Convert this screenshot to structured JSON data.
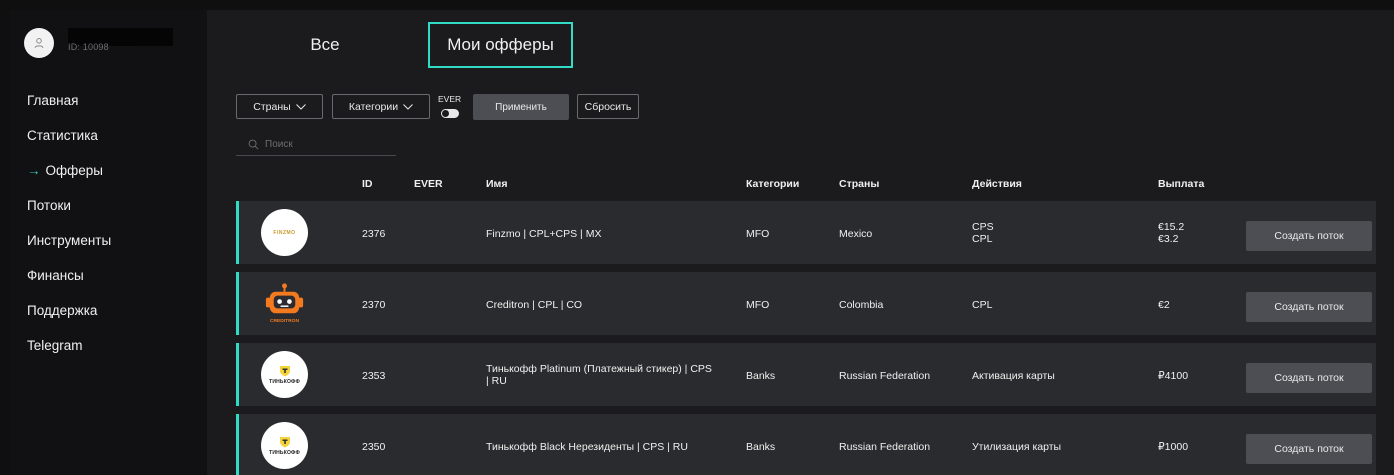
{
  "user": {
    "name": "████████",
    "id_label": "ID: 10098"
  },
  "sidebar": {
    "items": [
      {
        "label": "Главная",
        "active": false
      },
      {
        "label": "Статистика",
        "active": false
      },
      {
        "label": "→",
        "active": true
      },
      {
        "label": "Офферы",
        "active": true
      },
      {
        "label": "Потоки",
        "active": false
      },
      {
        "label": "Инструменты",
        "active": false
      },
      {
        "label": "Финансы",
        "active": false
      },
      {
        "label": "Поддержка",
        "active": false
      },
      {
        "label": "Telegram",
        "active": false
      }
    ]
  },
  "tabs": {
    "all": "Все",
    "mine": "Мои офферы"
  },
  "filters": {
    "countries": "Страны",
    "categories": "Категории",
    "ever": "EVER",
    "apply": "Применить",
    "reset": "Сбросить",
    "search_placeholder": "Поиск"
  },
  "table": {
    "headers": {
      "id": "ID",
      "ever": "EVER",
      "name": "Имя",
      "categories": "Категории",
      "countries": "Страны",
      "actions": "Действия",
      "payout": "Выплата"
    },
    "rows": [
      {
        "id": "2376",
        "name": "Finzmo | CPL+CPS | MX",
        "category": "MFO",
        "country": "Mexico",
        "actions": [
          "CPS",
          "CPL"
        ],
        "payouts": [
          "€15.2",
          "€3.2"
        ],
        "logo_text": "FINZMO",
        "button": "Создать поток"
      },
      {
        "id": "2370",
        "name": "Creditron | CPL | CO",
        "category": "MFO",
        "country": "Colombia",
        "actions": [
          "CPL"
        ],
        "payouts": [
          "€2"
        ],
        "logo_text": "CREDITRON",
        "button": "Создать поток"
      },
      {
        "id": "2353",
        "name": "Тинькофф Platinum (Платежный стикер) | CPS | RU",
        "category": "Banks",
        "country": "Russian Federation",
        "actions": [
          "Активация карты"
        ],
        "payouts": [
          "₽4100"
        ],
        "logo_text": "ТИНЬКОФФ",
        "button": "Создать поток"
      },
      {
        "id": "2350",
        "name": "Тинькофф Black Нерезиденты | CPS | RU",
        "category": "Banks",
        "country": "Russian Federation",
        "actions": [
          "Утилизация карты"
        ],
        "payouts": [
          "₽1000"
        ],
        "logo_text": "ТИНЬКОФФ",
        "button": "Создать поток"
      }
    ]
  },
  "colors": {
    "accent": "#2fdcc5",
    "row_bg": "#2a2b2e",
    "button_bg": "#4d4e54",
    "sidebar_bg": "#111113"
  }
}
